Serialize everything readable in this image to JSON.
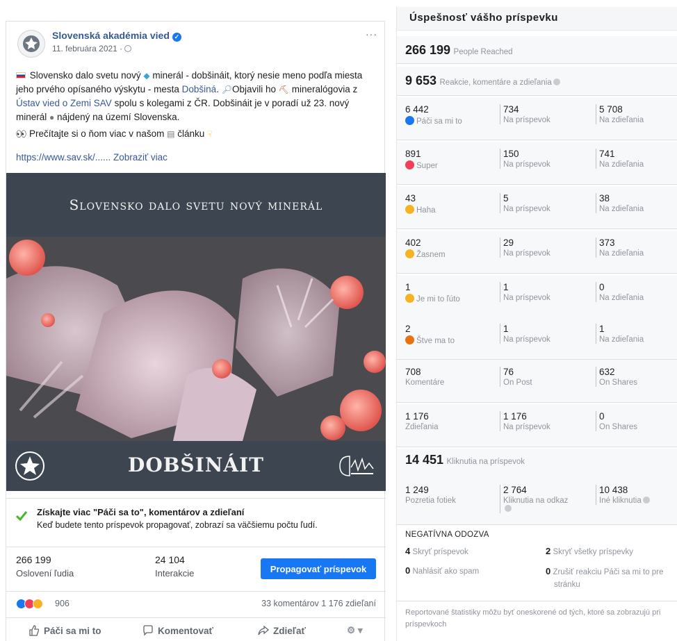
{
  "post": {
    "page_name": "Slovenská akadémia vied",
    "date": "11. februára 2021 ·",
    "more": "···",
    "text": {
      "p1_a": "Slovensko dalo svetu nový",
      "p1_b": "minerál - dobšináit, ktorý nesie meno podľa miesta jeho prvého opísaného výskytu - mesta",
      "p1_link1": "Dobšiná",
      "p1_c": ". ",
      "p1_d": "Objavili ho",
      "p1_e": "mineralógovia z",
      "p1_link2": "Ústav vied o Zemi SAV",
      "p1_f": "spolu s kolegami z ČR. Dobšináit je v poradí už 23. nový minerál",
      "p1_g": "nájdený na území Slovenska.",
      "p2_a": "Prečítajte si o ňom viac v našom",
      "p2_b": "článku"
    },
    "link": "https://www.sav.sk/...... Zobraziť viac",
    "image": {
      "title": "Slovensko dalo svetu nový minerál",
      "footer_title": "DOBŠINÁIT"
    },
    "promo": {
      "title": "Získajte viac \"Páči sa to\", komentárov a zdieľaní",
      "subtitle": "Keď budete tento príspevok propagovať, zobrazí sa väčšiemu počtu ľudí."
    },
    "metrics": {
      "reach_value": "266 199",
      "reach_label": "Oslovení ľudia",
      "engagement_value": "24 104",
      "engagement_label": "Interakcie",
      "promote_button": "Propagovať príspevok"
    },
    "reactions_count": "906",
    "comments_shares": "33 komentárov  1 176 zdieľaní",
    "actions": {
      "like": "Páči sa mi to",
      "comment": "Komentovať",
      "share": "Zdieľať"
    }
  },
  "stats": {
    "title": "Úspešnosť vášho príspevku",
    "reach_value": "266 199",
    "reach_label": "People Reached",
    "reactions_value": "9 653",
    "reactions_label": "Reakcie, komentáre a zdieľania",
    "rows": [
      {
        "total": "6 442",
        "label": "Páči sa mi to",
        "on_post": "734",
        "on_post_label": "Na príspevok",
        "on_shares": "5 708",
        "on_shares_label": "Na zdieľania",
        "color": "#1877f2"
      },
      {
        "total": "891",
        "label": "Super",
        "on_post": "150",
        "on_post_label": "Na príspevok",
        "on_shares": "741",
        "on_shares_label": "Na zdieľania",
        "color": "#f33e58"
      },
      {
        "total": "43",
        "label": "Haha",
        "on_post": "5",
        "on_post_label": "Na príspevok",
        "on_shares": "38",
        "on_shares_label": "Na zdieľania",
        "color": "#f7b125"
      },
      {
        "total": "402",
        "label": "Žasnem",
        "on_post": "29",
        "on_post_label": "Na príspevok",
        "on_shares": "373",
        "on_shares_label": "Na zdieľania",
        "color": "#f7b125"
      },
      {
        "total": "1",
        "label": "Je mi to ľúto",
        "on_post": "1",
        "on_post_label": "Na príspevok",
        "on_shares": "0",
        "on_shares_label": "Na zdieľania",
        "color": "#f7b125"
      },
      {
        "total": "2",
        "label": "Štve ma to",
        "on_post": "1",
        "on_post_label": "Na príspevok",
        "on_shares": "1",
        "on_shares_label": "Na zdieľania",
        "color": "#e9710f"
      },
      {
        "total": "708",
        "label": "Komentáre",
        "on_post": "76",
        "on_post_label": "On Post",
        "on_shares": "632",
        "on_shares_label": "On Shares",
        "color": ""
      },
      {
        "total": "1 176",
        "label": "Zdieľania",
        "on_post": "1 176",
        "on_post_label": "Na príspevok",
        "on_shares": "0",
        "on_shares_label": "On Shares",
        "color": ""
      }
    ],
    "clicks": {
      "value": "14 451",
      "label": "Kliknutia na príspevok",
      "photo_value": "1 249",
      "photo_label": "Pozretia fotiek",
      "link_value": "2 764",
      "link_label": "Kliknutia na odkaz",
      "other_value": "10 438",
      "other_label": "Iné kliknutia"
    },
    "negative": {
      "title": "NEGATÍVNA ODOZVA",
      "hide_post_value": "4",
      "hide_post_label": "Skryť príspevok",
      "hide_all_value": "2",
      "hide_all_label": "Skryť všetky príspevky",
      "spam_value": "0",
      "spam_label": "Nahlásiť ako spam",
      "unlike_value": "0",
      "unlike_label_1": "Zrušiť reakciu Páči sa mi to pre",
      "unlike_label_2": "stránku"
    },
    "footnote": "Reportované štatistiky môžu byť oneskorené od tých, ktoré sa zobrazujú pri príspevkoch"
  }
}
